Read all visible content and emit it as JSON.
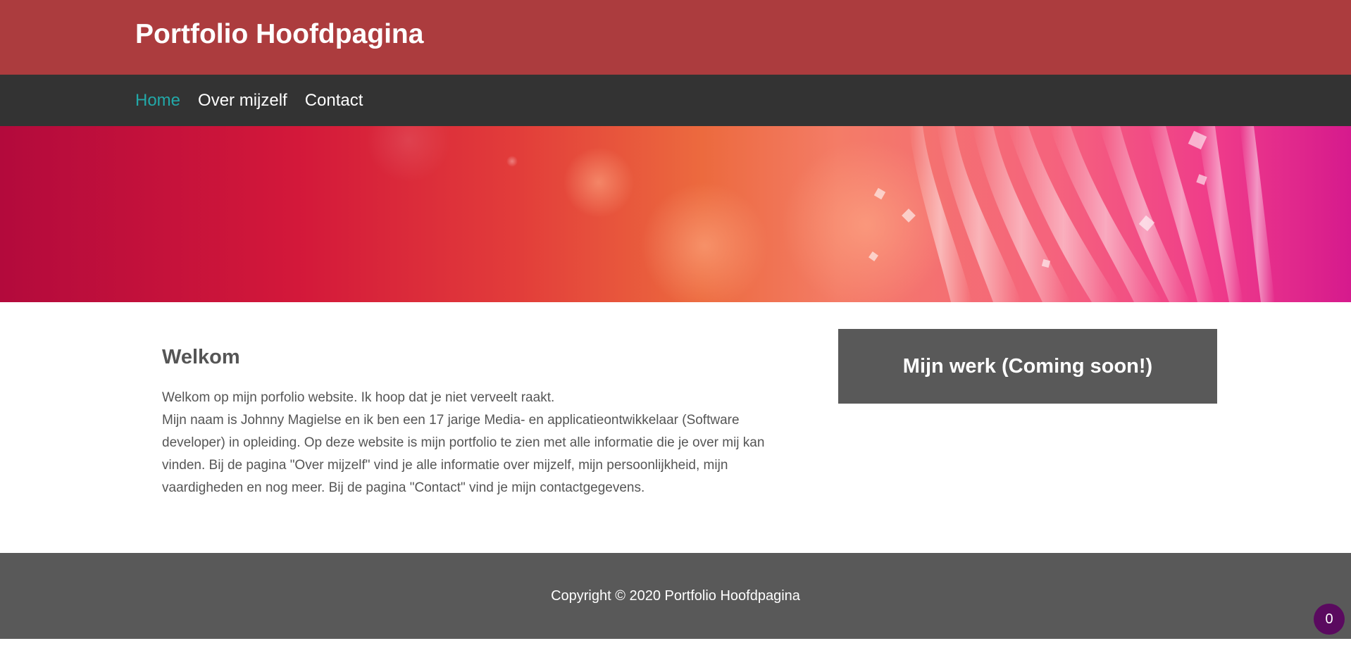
{
  "header": {
    "site_title": "Portfolio Hoofdpagina"
  },
  "nav": {
    "items": [
      {
        "label": "Home",
        "active": true
      },
      {
        "label": "Over mijzelf",
        "active": false
      },
      {
        "label": "Contact",
        "active": false
      }
    ]
  },
  "main": {
    "welcome_title": "Welkom",
    "welcome_line1": "Welkom op mijn porfolio website. Ik hoop dat je niet verveelt raakt.",
    "welcome_line2": "Mijn naam is Johnny Magielse en ik ben een 17 jarige Media- en applicatieontwikkelaar (Software developer) in opleiding. Op deze website is mijn portfolio te zien met alle informatie die je over mij kan vinden. Bij de pagina \"Over mijzelf\" vind je alle informatie over mijzelf, mijn persoonlijkheid, mijn vaardigheden en nog meer. Bij de pagina \"Contact\" vind je mijn contactgegevens."
  },
  "sidebar": {
    "work_title": "Mijn werk (Coming soon!)"
  },
  "footer": {
    "copyright": "Copyright © 2020 Portfolio Hoofdpagina"
  },
  "badge": {
    "count": "0"
  },
  "colors": {
    "header_bg": "#ac3c3e",
    "nav_bg": "#333333",
    "nav_active": "#22a8a8",
    "panel_bg": "#595959",
    "text": "#555555",
    "badge_bg": "#5a0a5f"
  }
}
